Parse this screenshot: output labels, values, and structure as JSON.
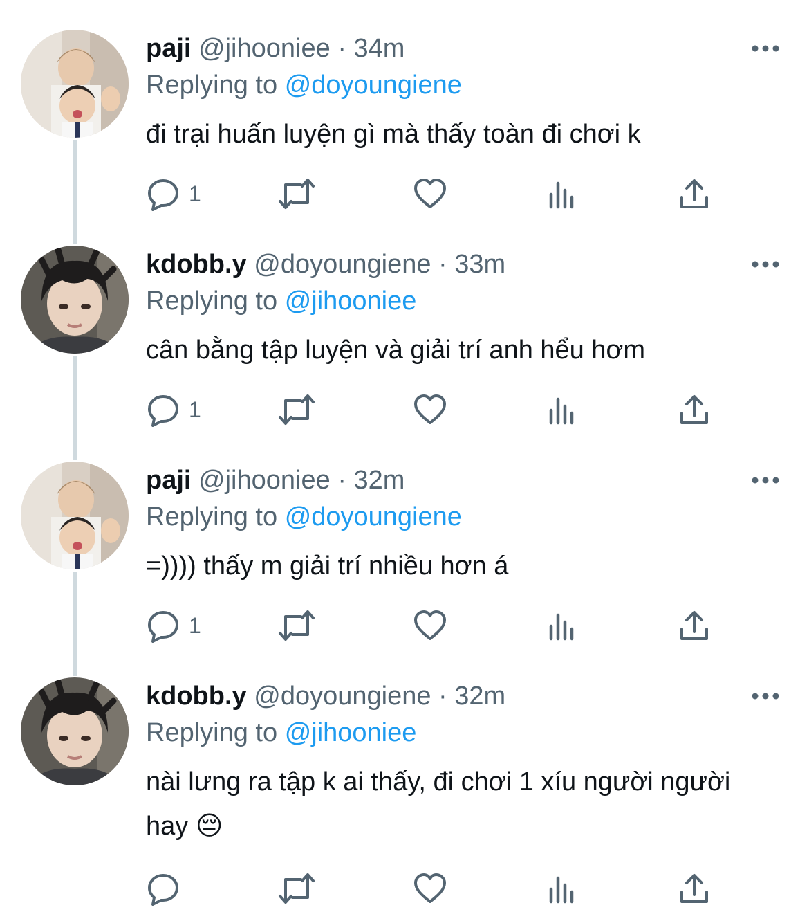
{
  "tweets": [
    {
      "name": "paji",
      "handle": "@jihooniee",
      "separator": "·",
      "time": "34m",
      "replying_prefix": "Replying to",
      "replying_to": "@doyoungiene",
      "text": "đi trại huấn luyện gì mà thấy toàn đi chơi k",
      "reply_count": "1",
      "avatar": "avatar-paji"
    },
    {
      "name": "kdobb.y",
      "handle": "@doyoungiene",
      "separator": "·",
      "time": "33m",
      "replying_prefix": "Replying to",
      "replying_to": "@jihooniee",
      "text": "cân bằng tập luyện và giải trí anh hểu hơm",
      "reply_count": "1",
      "avatar": "avatar-kdobby"
    },
    {
      "name": "paji",
      "handle": "@jihooniee",
      "separator": "·",
      "time": "32m",
      "replying_prefix": "Replying to",
      "replying_to": "@doyoungiene",
      "text": "=)))) thấy m giải trí nhiều hơn á",
      "reply_count": "1",
      "avatar": "avatar-paji"
    },
    {
      "name": "kdobb.y",
      "handle": "@doyoungiene",
      "separator": "·",
      "time": "32m",
      "replying_prefix": "Replying to",
      "replying_to": "@jihooniee",
      "text": "nài lưng ra tập k ai thấy, đi chơi 1 xíu người người hay 😔",
      "reply_count": "",
      "avatar": "avatar-kdobby"
    }
  ],
  "icons": {
    "reply": "reply-icon",
    "retweet": "retweet-icon",
    "like": "heart-icon",
    "analytics": "analytics-icon",
    "share": "share-icon",
    "more": "more-icon"
  },
  "colors": {
    "text": "#0f1419",
    "secondary": "#536471",
    "accent": "#1d9bf0",
    "thread_line": "#cfd9de"
  }
}
